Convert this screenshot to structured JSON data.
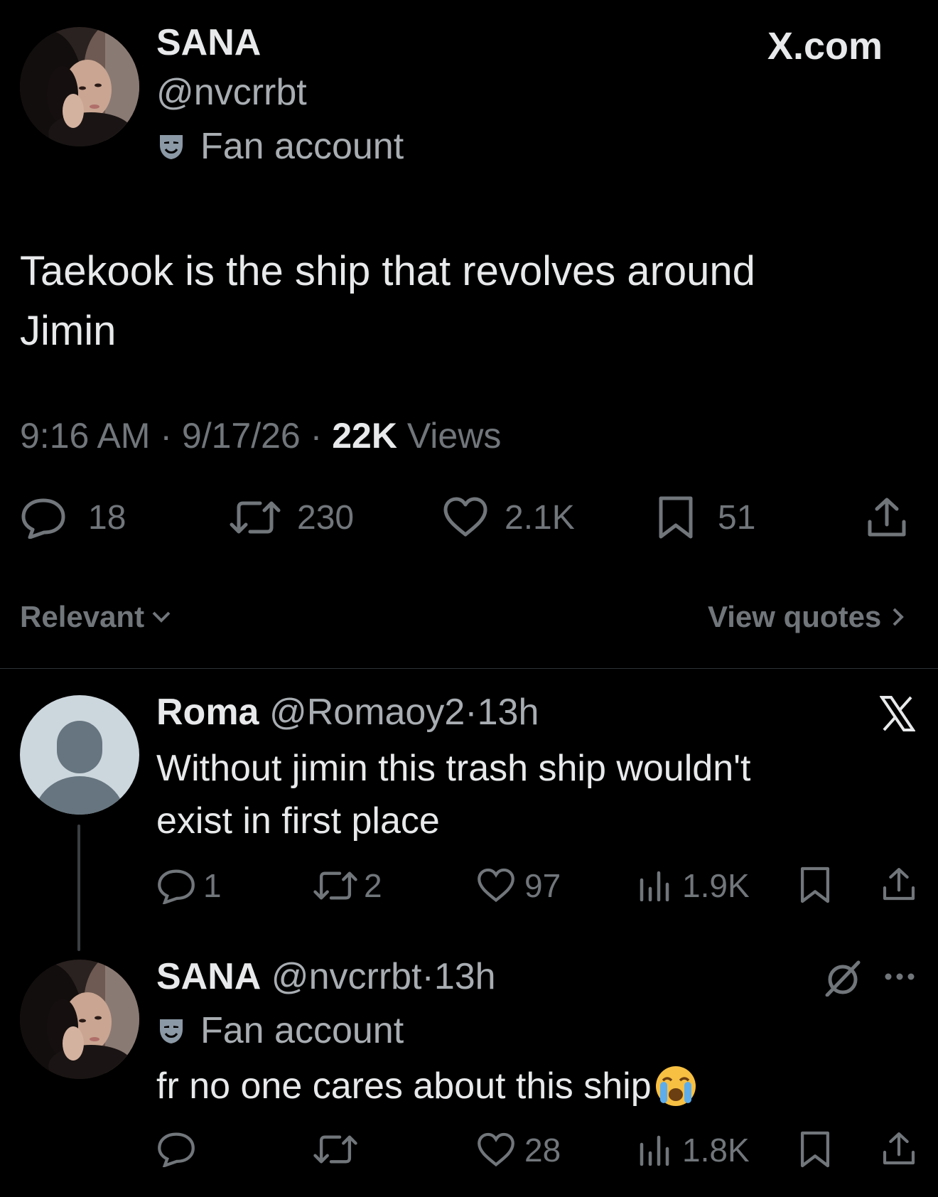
{
  "main_tweet": {
    "author_name": "SANA",
    "handle": "@nvcrrbt",
    "badge_label": "Fan account",
    "site_label": "X.com",
    "text_line1": "Taekook is the ship that revolves around",
    "text_line2": "Jimin",
    "time": "9:16 AM",
    "date": "9/17/26",
    "separator": "·",
    "views_count": "22K",
    "views_label": "Views",
    "replies": "18",
    "reposts": "230",
    "likes": "2.1K",
    "bookmarks": "51"
  },
  "sort": {
    "label": "Relevant",
    "view_quotes": "View quotes"
  },
  "reply1": {
    "author_name": "Roma",
    "handle": "@Romaoy2",
    "separator": "·",
    "time": "13h",
    "text_line1": "Without jimin this trash ship wouldn't",
    "text_line2": "exist in first place",
    "replies": "1",
    "reposts": "2",
    "likes": "97",
    "views": "1.9K"
  },
  "reply2": {
    "author_name": "SANA",
    "handle": "@nvcrrbt",
    "separator": "·",
    "time": "13h",
    "badge_label": "Fan account",
    "text": "fr no one cares about this ship",
    "emoji": "😭",
    "likes": "28",
    "views": "1.8K"
  },
  "colors": {
    "background": "#000000",
    "text": "#e7e9ea",
    "muted": "#71767b",
    "divider": "#2f3336"
  }
}
